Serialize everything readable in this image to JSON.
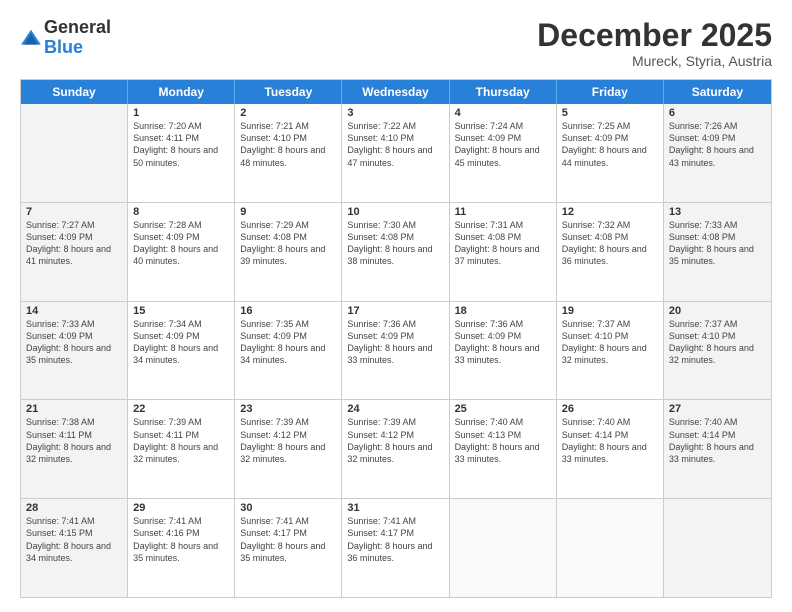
{
  "logo": {
    "general": "General",
    "blue": "Blue"
  },
  "title": "December 2025",
  "subtitle": "Mureck, Styria, Austria",
  "header_days": [
    "Sunday",
    "Monday",
    "Tuesday",
    "Wednesday",
    "Thursday",
    "Friday",
    "Saturday"
  ],
  "weeks": [
    [
      {
        "day": "",
        "sunrise": "",
        "sunset": "",
        "daylight": "",
        "shaded": true
      },
      {
        "day": "1",
        "sunrise": "Sunrise: 7:20 AM",
        "sunset": "Sunset: 4:11 PM",
        "daylight": "Daylight: 8 hours and 50 minutes.",
        "shaded": false
      },
      {
        "day": "2",
        "sunrise": "Sunrise: 7:21 AM",
        "sunset": "Sunset: 4:10 PM",
        "daylight": "Daylight: 8 hours and 48 minutes.",
        "shaded": false
      },
      {
        "day": "3",
        "sunrise": "Sunrise: 7:22 AM",
        "sunset": "Sunset: 4:10 PM",
        "daylight": "Daylight: 8 hours and 47 minutes.",
        "shaded": false
      },
      {
        "day": "4",
        "sunrise": "Sunrise: 7:24 AM",
        "sunset": "Sunset: 4:09 PM",
        "daylight": "Daylight: 8 hours and 45 minutes.",
        "shaded": false
      },
      {
        "day": "5",
        "sunrise": "Sunrise: 7:25 AM",
        "sunset": "Sunset: 4:09 PM",
        "daylight": "Daylight: 8 hours and 44 minutes.",
        "shaded": false
      },
      {
        "day": "6",
        "sunrise": "Sunrise: 7:26 AM",
        "sunset": "Sunset: 4:09 PM",
        "daylight": "Daylight: 8 hours and 43 minutes.",
        "shaded": true
      }
    ],
    [
      {
        "day": "7",
        "sunrise": "Sunrise: 7:27 AM",
        "sunset": "Sunset: 4:09 PM",
        "daylight": "Daylight: 8 hours and 41 minutes.",
        "shaded": true
      },
      {
        "day": "8",
        "sunrise": "Sunrise: 7:28 AM",
        "sunset": "Sunset: 4:09 PM",
        "daylight": "Daylight: 8 hours and 40 minutes.",
        "shaded": false
      },
      {
        "day": "9",
        "sunrise": "Sunrise: 7:29 AM",
        "sunset": "Sunset: 4:08 PM",
        "daylight": "Daylight: 8 hours and 39 minutes.",
        "shaded": false
      },
      {
        "day": "10",
        "sunrise": "Sunrise: 7:30 AM",
        "sunset": "Sunset: 4:08 PM",
        "daylight": "Daylight: 8 hours and 38 minutes.",
        "shaded": false
      },
      {
        "day": "11",
        "sunrise": "Sunrise: 7:31 AM",
        "sunset": "Sunset: 4:08 PM",
        "daylight": "Daylight: 8 hours and 37 minutes.",
        "shaded": false
      },
      {
        "day": "12",
        "sunrise": "Sunrise: 7:32 AM",
        "sunset": "Sunset: 4:08 PM",
        "daylight": "Daylight: 8 hours and 36 minutes.",
        "shaded": false
      },
      {
        "day": "13",
        "sunrise": "Sunrise: 7:33 AM",
        "sunset": "Sunset: 4:08 PM",
        "daylight": "Daylight: 8 hours and 35 minutes.",
        "shaded": true
      }
    ],
    [
      {
        "day": "14",
        "sunrise": "Sunrise: 7:33 AM",
        "sunset": "Sunset: 4:09 PM",
        "daylight": "Daylight: 8 hours and 35 minutes.",
        "shaded": true
      },
      {
        "day": "15",
        "sunrise": "Sunrise: 7:34 AM",
        "sunset": "Sunset: 4:09 PM",
        "daylight": "Daylight: 8 hours and 34 minutes.",
        "shaded": false
      },
      {
        "day": "16",
        "sunrise": "Sunrise: 7:35 AM",
        "sunset": "Sunset: 4:09 PM",
        "daylight": "Daylight: 8 hours and 34 minutes.",
        "shaded": false
      },
      {
        "day": "17",
        "sunrise": "Sunrise: 7:36 AM",
        "sunset": "Sunset: 4:09 PM",
        "daylight": "Daylight: 8 hours and 33 minutes.",
        "shaded": false
      },
      {
        "day": "18",
        "sunrise": "Sunrise: 7:36 AM",
        "sunset": "Sunset: 4:09 PM",
        "daylight": "Daylight: 8 hours and 33 minutes.",
        "shaded": false
      },
      {
        "day": "19",
        "sunrise": "Sunrise: 7:37 AM",
        "sunset": "Sunset: 4:10 PM",
        "daylight": "Daylight: 8 hours and 32 minutes.",
        "shaded": false
      },
      {
        "day": "20",
        "sunrise": "Sunrise: 7:37 AM",
        "sunset": "Sunset: 4:10 PM",
        "daylight": "Daylight: 8 hours and 32 minutes.",
        "shaded": true
      }
    ],
    [
      {
        "day": "21",
        "sunrise": "Sunrise: 7:38 AM",
        "sunset": "Sunset: 4:11 PM",
        "daylight": "Daylight: 8 hours and 32 minutes.",
        "shaded": true
      },
      {
        "day": "22",
        "sunrise": "Sunrise: 7:39 AM",
        "sunset": "Sunset: 4:11 PM",
        "daylight": "Daylight: 8 hours and 32 minutes.",
        "shaded": false
      },
      {
        "day": "23",
        "sunrise": "Sunrise: 7:39 AM",
        "sunset": "Sunset: 4:12 PM",
        "daylight": "Daylight: 8 hours and 32 minutes.",
        "shaded": false
      },
      {
        "day": "24",
        "sunrise": "Sunrise: 7:39 AM",
        "sunset": "Sunset: 4:12 PM",
        "daylight": "Daylight: 8 hours and 32 minutes.",
        "shaded": false
      },
      {
        "day": "25",
        "sunrise": "Sunrise: 7:40 AM",
        "sunset": "Sunset: 4:13 PM",
        "daylight": "Daylight: 8 hours and 33 minutes.",
        "shaded": false
      },
      {
        "day": "26",
        "sunrise": "Sunrise: 7:40 AM",
        "sunset": "Sunset: 4:14 PM",
        "daylight": "Daylight: 8 hours and 33 minutes.",
        "shaded": false
      },
      {
        "day": "27",
        "sunrise": "Sunrise: 7:40 AM",
        "sunset": "Sunset: 4:14 PM",
        "daylight": "Daylight: 8 hours and 33 minutes.",
        "shaded": true
      }
    ],
    [
      {
        "day": "28",
        "sunrise": "Sunrise: 7:41 AM",
        "sunset": "Sunset: 4:15 PM",
        "daylight": "Daylight: 8 hours and 34 minutes.",
        "shaded": true
      },
      {
        "day": "29",
        "sunrise": "Sunrise: 7:41 AM",
        "sunset": "Sunset: 4:16 PM",
        "daylight": "Daylight: 8 hours and 35 minutes.",
        "shaded": false
      },
      {
        "day": "30",
        "sunrise": "Sunrise: 7:41 AM",
        "sunset": "Sunset: 4:17 PM",
        "daylight": "Daylight: 8 hours and 35 minutes.",
        "shaded": false
      },
      {
        "day": "31",
        "sunrise": "Sunrise: 7:41 AM",
        "sunset": "Sunset: 4:17 PM",
        "daylight": "Daylight: 8 hours and 36 minutes.",
        "shaded": false
      },
      {
        "day": "",
        "sunrise": "",
        "sunset": "",
        "daylight": "",
        "shaded": false
      },
      {
        "day": "",
        "sunrise": "",
        "sunset": "",
        "daylight": "",
        "shaded": false
      },
      {
        "day": "",
        "sunrise": "",
        "sunset": "",
        "daylight": "",
        "shaded": true
      }
    ]
  ]
}
